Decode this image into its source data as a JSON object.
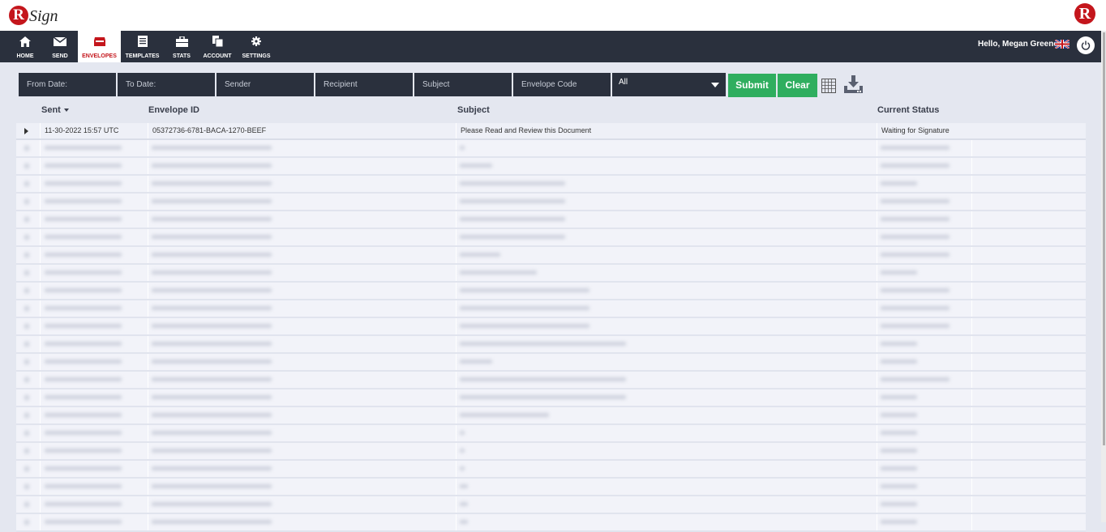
{
  "brand": {
    "logo_letter": "R",
    "logo_text": "Sign",
    "right_logo_letter": "R",
    "accent": "#c4161c"
  },
  "nav": {
    "items": [
      {
        "label": "HOME",
        "icon": "home-icon"
      },
      {
        "label": "SEND",
        "icon": "envelope-icon"
      },
      {
        "label": "ENVELOPES",
        "icon": "mailbox-icon",
        "active": true
      },
      {
        "label": "TEMPLATES",
        "icon": "document-icon"
      },
      {
        "label": "STATS",
        "icon": "briefcase-icon"
      },
      {
        "label": "ACCOUNT",
        "icon": "copy-icon"
      },
      {
        "label": "SETTINGS",
        "icon": "gear-icon"
      }
    ],
    "greeting": "Hello, Megan Greene"
  },
  "filters": {
    "from_date": "From Date:",
    "to_date": "To Date:",
    "sender": "Sender",
    "recipient": "Recipient",
    "subject": "Subject",
    "envelope_code": "Envelope Code",
    "status_select": "All",
    "submit": "Submit",
    "clear": "Clear"
  },
  "table": {
    "headers": {
      "sent": "Sent",
      "envelope_id": "Envelope ID",
      "subject": "Subject",
      "status": "Current Status"
    },
    "rows": [
      {
        "sent": "11-30-2022 15:57 UTC",
        "envelope_id": "05372736-6781-BACA-1270-BEEF",
        "subject": "Please Read and Review this Document",
        "status": "Waiting for Signature"
      }
    ]
  },
  "colors": {
    "nav_bg": "#2a303d",
    "button_green": "#2fae5f",
    "page_bg": "#e4e7f0"
  }
}
